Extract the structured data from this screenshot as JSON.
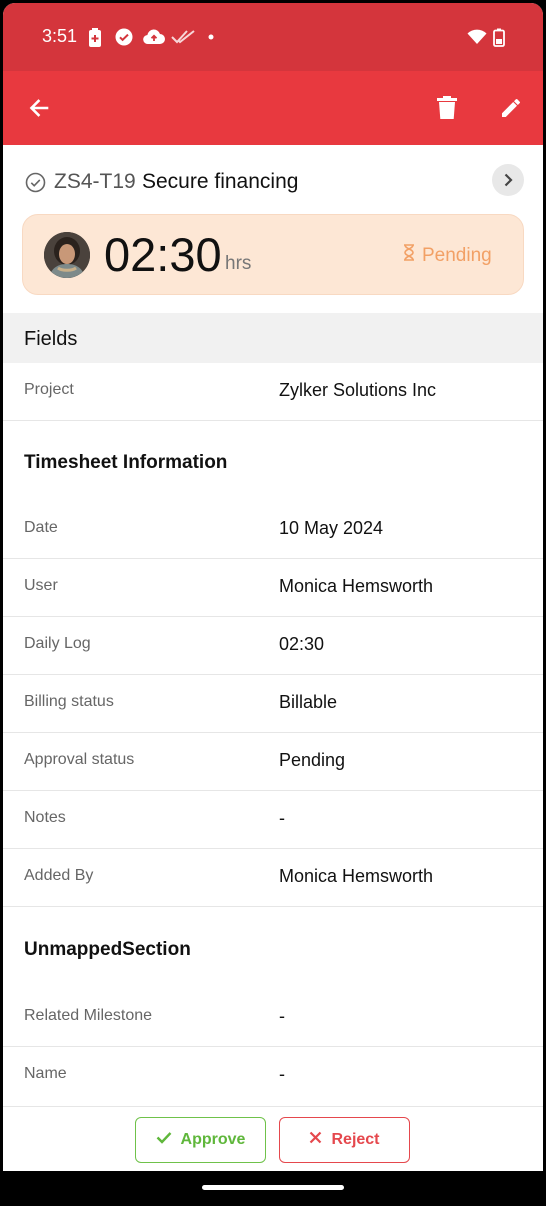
{
  "status_bar": {
    "time": "3:51",
    "left_icons": [
      "battery-saver-icon",
      "check-circle-icon",
      "cloud-upload-icon",
      "double-check-icon",
      "dot-icon"
    ],
    "right_icons": [
      "wifi-icon",
      "battery-icon"
    ]
  },
  "app_bar": {
    "color": "#e8393f",
    "icons": [
      "back-arrow-icon",
      "delete-icon",
      "edit-icon"
    ]
  },
  "task": {
    "id": "ZS4-T19",
    "name": "Secure financing"
  },
  "hours_card": {
    "hours": "02:30",
    "unit": "hrs",
    "status": "Pending",
    "status_color": "#f2a065"
  },
  "fields_section": {
    "title": "Fields",
    "project_label": "Project",
    "project_value": "Zylker Solutions Inc"
  },
  "timesheet_section": {
    "title": "Timesheet Information",
    "rows": [
      {
        "label": "Date",
        "value": "10 May 2024"
      },
      {
        "label": "User",
        "value": "Monica Hemsworth"
      },
      {
        "label": "Daily Log",
        "value": "02:30"
      },
      {
        "label": "Billing status",
        "value": "Billable"
      },
      {
        "label": "Approval status",
        "value": "Pending"
      },
      {
        "label": "Notes",
        "value": "-"
      },
      {
        "label": "Added By",
        "value": "Monica Hemsworth"
      }
    ]
  },
  "unmapped_section": {
    "title": "UnmappedSection",
    "rows": [
      {
        "label": "Related Milestone",
        "value": "-"
      },
      {
        "label": "Name",
        "value": "-"
      }
    ]
  },
  "actions": {
    "approve_label": "Approve",
    "approve_color": "#5fb73b",
    "reject_label": "Reject",
    "reject_color": "#e5484d"
  }
}
